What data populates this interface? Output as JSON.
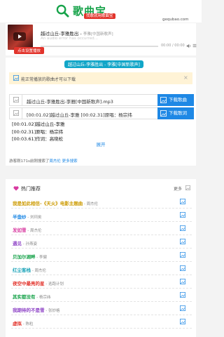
{
  "header": {
    "logo_text": "歌曲宝",
    "slogan": "找歌就用歌曲宝",
    "domain": "gequbao.com"
  },
  "player": {
    "song_title": "越过山丘-李雅胜出 - ",
    "song_title_sub": "李雅[中国新歌声]",
    "error_msg": "An audio error has occurred...",
    "time": "00:00 / 00:00",
    "cover_label": "点击设置播放"
  },
  "card1": {
    "ribbon": "越过山丘-李雅胜出 - 李雅[中国新歌声]",
    "notice": "能正常播放的歌曲才可以下载",
    "mp3_row": "越过山丘-李雅胜出-李雅[中国新歌声].mp3",
    "mp3_button": "下载歌曲",
    "lrc_row": "[00:01.02]越过山丘-李雅 [00:02.31]原唱：杨宗纬",
    "lrc_button": "下载歌词",
    "lyrics": [
      "[00:01.02]越过山丘-李雅",
      "[00:02.31]原唱：杨宗纬",
      "[00:03.61]作词：高晓松"
    ],
    "expand": "展开",
    "search_prefix": "游客刚171s前刚搜索了",
    "search_link1": "周杰伦",
    "search_sep": "  ",
    "search_link2": "更多搜索"
  },
  "hot": {
    "title": "热门推荐",
    "more": "更多",
    "items": [
      {
        "name": "我是如此相信-《天火》电影主题曲",
        "artist": " - 周杰伦",
        "color": "#cc9a00"
      },
      {
        "name": "半壶纱",
        "artist": " - 刘珂矣",
        "color": "#1e88e5"
      },
      {
        "name": "发如雪",
        "artist": " - 周杰伦",
        "color": "#d83aa0"
      },
      {
        "name": "遇见",
        "artist": " - 孙燕姿",
        "color": "#8e44c6"
      },
      {
        "name": "贝加尔湖畔",
        "artist": " - 李健",
        "color": "#17a34a"
      },
      {
        "name": "红尘客栈",
        "artist": " - 周杰伦",
        "color": "#1ba3b8"
      },
      {
        "name": "夜空中最亮的星",
        "artist": " - 逃跑计划",
        "color": "#e2342c"
      },
      {
        "name": "其实都没有",
        "artist": " - 杨宗纬",
        "color": "#17a34a"
      },
      {
        "name": "我期待的不是雪",
        "artist": " - 张妙格",
        "color": "#8e44c6"
      },
      {
        "name": "虚拟",
        "artist": " - 陈粒",
        "color": "#e2342c"
      }
    ]
  },
  "colors": {
    "brand_green": "#17a34a",
    "accent_blue": "#1e88e5",
    "ribbon_teal": "#12a6c8",
    "red": "#e2342c"
  }
}
